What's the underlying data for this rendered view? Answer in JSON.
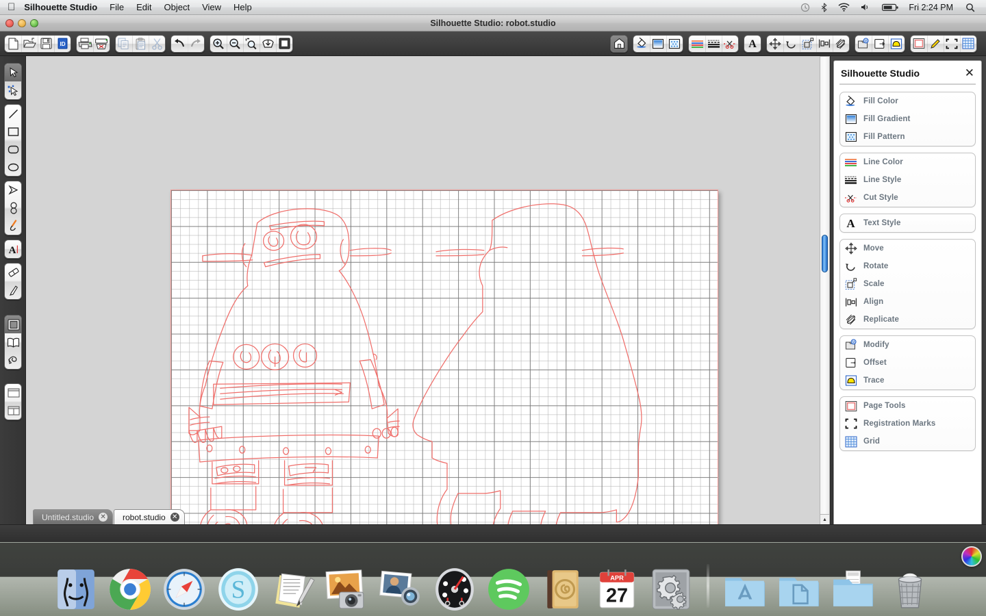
{
  "menubar": {
    "apple_icon": "apple-icon",
    "app_name": "Silhouette Studio",
    "menus": [
      "File",
      "Edit",
      "Object",
      "View",
      "Help"
    ],
    "status_icons": [
      "time-machine-icon",
      "bluetooth-icon",
      "wifi-icon",
      "volume-icon",
      "battery-icon"
    ],
    "clock": "Fri 2:24 PM",
    "spotlight_icon": "search-icon"
  },
  "window": {
    "title": "Silhouette Studio: robot.studio",
    "traffic_lights": [
      "close-button",
      "minimize-button",
      "zoom-button"
    ]
  },
  "toolbar": {
    "groups": [
      {
        "name": "file-group",
        "buttons": [
          {
            "name": "new-document-button",
            "icon": "new-document-icon"
          },
          {
            "name": "open-document-button",
            "icon": "open-folder-icon"
          },
          {
            "name": "save-document-button",
            "icon": "floppy-disk-icon"
          },
          {
            "name": "save-to-library-button",
            "icon": "library-save-icon"
          }
        ]
      },
      {
        "name": "output-group",
        "buttons": [
          {
            "name": "print-button",
            "icon": "printer-icon"
          },
          {
            "name": "send-to-silhouette-button",
            "icon": "cutter-icon"
          }
        ]
      },
      {
        "name": "clipboard-group",
        "buttons": [
          {
            "name": "copy-button",
            "icon": "copy-icon"
          },
          {
            "name": "paste-button",
            "icon": "clipboard-icon"
          },
          {
            "name": "cut-button",
            "icon": "scissors-icon"
          }
        ]
      },
      {
        "name": "history-group",
        "buttons": [
          {
            "name": "undo-button",
            "icon": "undo-arrow-icon"
          },
          {
            "name": "redo-button",
            "icon": "redo-arrow-icon"
          }
        ]
      },
      {
        "name": "zoom-group",
        "buttons": [
          {
            "name": "zoom-in-button",
            "icon": "magnifier-plus-icon"
          },
          {
            "name": "zoom-out-button",
            "icon": "magnifier-minus-icon"
          },
          {
            "name": "zoom-selection-button",
            "icon": "magnifier-selection-icon"
          },
          {
            "name": "fit-to-page-button",
            "icon": "fit-page-icon"
          },
          {
            "name": "actual-size-button",
            "icon": "actual-size-icon"
          }
        ]
      },
      {
        "name": "library-group",
        "buttons": [
          {
            "name": "my-library-button",
            "icon": "house-icon"
          }
        ]
      },
      {
        "name": "fill-group",
        "buttons": [
          {
            "name": "fill-color-button",
            "icon": "paint-bucket-icon"
          },
          {
            "name": "fill-gradient-button",
            "icon": "gradient-square-icon"
          },
          {
            "name": "fill-pattern-button",
            "icon": "pattern-square-icon"
          }
        ]
      },
      {
        "name": "line-group",
        "buttons": [
          {
            "name": "line-color-button",
            "icon": "color-stripes-icon"
          },
          {
            "name": "line-style-button",
            "icon": "line-styles-icon"
          },
          {
            "name": "cut-style-button",
            "icon": "scissors-dashed-icon"
          }
        ]
      },
      {
        "name": "text-group",
        "buttons": [
          {
            "name": "text-style-button",
            "icon": "letter-a-icon"
          }
        ]
      },
      {
        "name": "transform-group",
        "buttons": [
          {
            "name": "move-button",
            "icon": "move-arrows-icon"
          },
          {
            "name": "rotate-button",
            "icon": "rotate-arrow-icon"
          },
          {
            "name": "scale-button",
            "icon": "scale-box-icon"
          },
          {
            "name": "align-button",
            "icon": "align-icon"
          },
          {
            "name": "replicate-button",
            "icon": "replicate-icon"
          }
        ]
      },
      {
        "name": "path-group",
        "buttons": [
          {
            "name": "modify-button",
            "icon": "modify-icon"
          },
          {
            "name": "offset-button",
            "icon": "offset-icon"
          },
          {
            "name": "trace-button",
            "icon": "trace-icon"
          }
        ]
      },
      {
        "name": "page-group",
        "buttons": [
          {
            "name": "page-tools-button",
            "icon": "page-frame-icon"
          },
          {
            "name": "sketch-pen-button",
            "icon": "pencil-icon"
          },
          {
            "name": "registration-marks-button",
            "icon": "registration-marks-icon"
          },
          {
            "name": "grid-button",
            "icon": "grid-icon"
          }
        ]
      }
    ]
  },
  "tool_palette": {
    "groups": [
      {
        "name": "selection-tools",
        "tools": [
          {
            "name": "select-tool",
            "icon": "arrow-cursor-icon",
            "selected": true
          },
          {
            "name": "edit-points-tool",
            "icon": "edit-points-icon",
            "selected": false
          }
        ]
      },
      {
        "name": "shape-tools",
        "tools": [
          {
            "name": "line-tool",
            "icon": "line-icon",
            "selected": false
          },
          {
            "name": "rectangle-tool",
            "icon": "rectangle-icon",
            "selected": false
          },
          {
            "name": "rounded-rectangle-tool",
            "icon": "rounded-rectangle-icon",
            "selected": false
          },
          {
            "name": "ellipse-tool",
            "icon": "ellipse-icon",
            "selected": false
          }
        ]
      },
      {
        "name": "draw-tools",
        "tools": [
          {
            "name": "polygon-tool",
            "icon": "polygon-icon",
            "selected": false
          },
          {
            "name": "curve-tool",
            "icon": "curve-icon",
            "selected": false
          },
          {
            "name": "freehand-tool",
            "icon": "freehand-pen-icon",
            "selected": false
          }
        ]
      },
      {
        "name": "text-tools",
        "tools": [
          {
            "name": "text-tool",
            "icon": "letter-a-cursor-icon",
            "selected": false
          }
        ]
      },
      {
        "name": "edit-tools",
        "tools": [
          {
            "name": "eraser-tool",
            "icon": "eraser-icon",
            "selected": false
          },
          {
            "name": "knife-tool",
            "icon": "knife-icon",
            "selected": false
          }
        ]
      },
      {
        "name": "view-tools",
        "tools": [
          {
            "name": "design-page-tool",
            "icon": "design-page-icon",
            "selected": true
          },
          {
            "name": "library-tool",
            "icon": "open-book-icon",
            "selected": false
          },
          {
            "name": "send-tool",
            "icon": "send-cut-icon",
            "selected": false
          }
        ]
      },
      {
        "name": "layout-tools",
        "tools": [
          {
            "name": "single-view-button",
            "icon": "single-pane-icon",
            "selected": false
          },
          {
            "name": "split-view-button",
            "icon": "split-pane-icon",
            "selected": false
          }
        ]
      }
    ]
  },
  "panel": {
    "title": "Silhouette Studio",
    "close_icon": "close-icon",
    "groups": [
      {
        "name": "fill-group",
        "items": [
          {
            "label": "Fill Color",
            "icon": "paint-bucket-icon"
          },
          {
            "label": "Fill Gradient",
            "icon": "gradient-square-icon"
          },
          {
            "label": "Fill Pattern",
            "icon": "pattern-square-icon"
          }
        ]
      },
      {
        "name": "line-group",
        "items": [
          {
            "label": "Line Color",
            "icon": "color-stripes-icon"
          },
          {
            "label": "Line Style",
            "icon": "line-styles-icon"
          },
          {
            "label": "Cut Style",
            "icon": "scissors-dashed-icon"
          }
        ]
      },
      {
        "name": "text-group",
        "items": [
          {
            "label": "Text Style",
            "icon": "letter-a-icon"
          }
        ]
      },
      {
        "name": "transform-group",
        "items": [
          {
            "label": "Move",
            "icon": "move-arrows-icon"
          },
          {
            "label": "Rotate",
            "icon": "rotate-arrow-icon"
          },
          {
            "label": "Scale",
            "icon": "scale-box-icon"
          },
          {
            "label": "Align",
            "icon": "align-icon"
          },
          {
            "label": "Replicate",
            "icon": "replicate-icon"
          }
        ]
      },
      {
        "name": "path-group",
        "items": [
          {
            "label": "Modify",
            "icon": "modify-icon"
          },
          {
            "label": "Offset",
            "icon": "offset-icon"
          },
          {
            "label": "Trace",
            "icon": "trace-icon"
          }
        ]
      },
      {
        "name": "page-group",
        "items": [
          {
            "label": "Page Tools",
            "icon": "page-frame-icon"
          },
          {
            "label": "Registration Marks",
            "icon": "registration-marks-icon"
          },
          {
            "label": "Grid",
            "icon": "grid-icon"
          }
        ]
      }
    ]
  },
  "tabs": [
    {
      "label": "Untitled.studio",
      "active": false,
      "close_icon": "close-icon"
    },
    {
      "label": "robot.studio",
      "active": true,
      "close_icon": "close-icon"
    }
  ],
  "canvas": {
    "artwork_name": "robot-trace-drawing",
    "line_color": "#ef6e6a",
    "page_border_color": "#f39a96",
    "grid_major_color": "#787878",
    "grid_minor_color": "#afafaf",
    "background_color": "#d4d4d4"
  },
  "scrollbars": {
    "vertical_thumb_color": "#2a78d8",
    "horizontal_thumb_color": "#2a78d8"
  },
  "dock": {
    "items": [
      {
        "name": "finder",
        "icon": "finder-icon"
      },
      {
        "name": "google-chrome",
        "icon": "chrome-icon"
      },
      {
        "name": "safari",
        "icon": "safari-compass-icon"
      },
      {
        "name": "skype",
        "icon": "skype-s-icon"
      },
      {
        "name": "textedit",
        "icon": "textedit-page-pen-icon"
      },
      {
        "name": "iphoto",
        "icon": "iphoto-camera-icon"
      },
      {
        "name": "photo-booth",
        "icon": "photobooth-icon"
      },
      {
        "name": "dashboard",
        "icon": "dashboard-gauge-icon"
      },
      {
        "name": "spotify",
        "icon": "spotify-icon"
      },
      {
        "name": "address-book",
        "icon": "address-book-icon"
      },
      {
        "name": "calendar",
        "icon": "calendar-icon",
        "month": "APR",
        "day": "27"
      },
      {
        "name": "system-preferences",
        "icon": "gears-icon"
      },
      {
        "name": "dock-divider",
        "icon": "divider-icon"
      },
      {
        "name": "applications-folder",
        "icon": "applications-folder-icon"
      },
      {
        "name": "documents-folder",
        "icon": "documents-folder-icon"
      },
      {
        "name": "downloads-folder",
        "icon": "downloads-folder-icon"
      },
      {
        "name": "trash",
        "icon": "trash-icon"
      }
    ]
  }
}
